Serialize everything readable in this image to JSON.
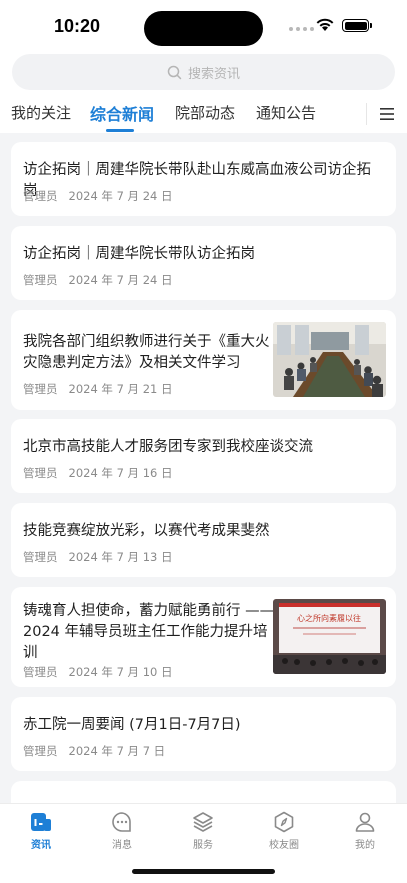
{
  "status": {
    "time": "10:20"
  },
  "search": {
    "placeholder": "搜索资讯"
  },
  "tabs": [
    {
      "label": "我的关注",
      "active": false
    },
    {
      "label": "综合新闻",
      "active": true
    },
    {
      "label": "院部动态",
      "active": false
    },
    {
      "label": "通知公告",
      "active": false
    }
  ],
  "colors": {
    "accent": "#1e7fd6",
    "background": "#f3f4f6"
  },
  "articles": [
    {
      "title": "访企拓岗｜周建华院长带队赴山东威高血液公司访企拓岗",
      "author": "管理员",
      "date": "2024 年 7 月 24 日",
      "has_image": false
    },
    {
      "title": "访企拓岗｜周建华院长带队访企拓岗",
      "author": "管理员",
      "date": "2024 年 7 月 24 日",
      "has_image": false
    },
    {
      "title": "我院各部门组织教师进行关于《重大火灾隐患判定方法》及相关文件学习",
      "author": "管理员",
      "date": "2024 年 7 月 21 日",
      "has_image": true
    },
    {
      "title": "北京市高技能人才服务团专家到我校座谈交流",
      "author": "管理员",
      "date": "2024 年 7 月 16 日",
      "has_image": false
    },
    {
      "title": "技能竞赛绽放光彩，以赛代考成果斐然",
      "author": "管理员",
      "date": "2024 年 7 月 13 日",
      "has_image": false
    },
    {
      "title": "铸魂育人担使命，蓄力赋能勇前行 —— 2024 年辅导员班主任工作能力提升培训",
      "author": "管理员",
      "date": "2024 年 7 月 10 日",
      "has_image": true
    },
    {
      "title": "赤工院一周要闻 (7月1日-7月7日)",
      "author": "管理员",
      "date": "2024 年 7 月 7 日",
      "has_image": false
    }
  ],
  "thumb2_banner": "心之所向素履以往",
  "bottom_nav": [
    {
      "label": "资讯",
      "icon": "news-icon",
      "active": true
    },
    {
      "label": "消息",
      "icon": "message-icon",
      "active": false
    },
    {
      "label": "服务",
      "icon": "layers-icon",
      "active": false
    },
    {
      "label": "校友圈",
      "icon": "compass-icon",
      "active": false
    },
    {
      "label": "我的",
      "icon": "user-icon",
      "active": false
    }
  ]
}
